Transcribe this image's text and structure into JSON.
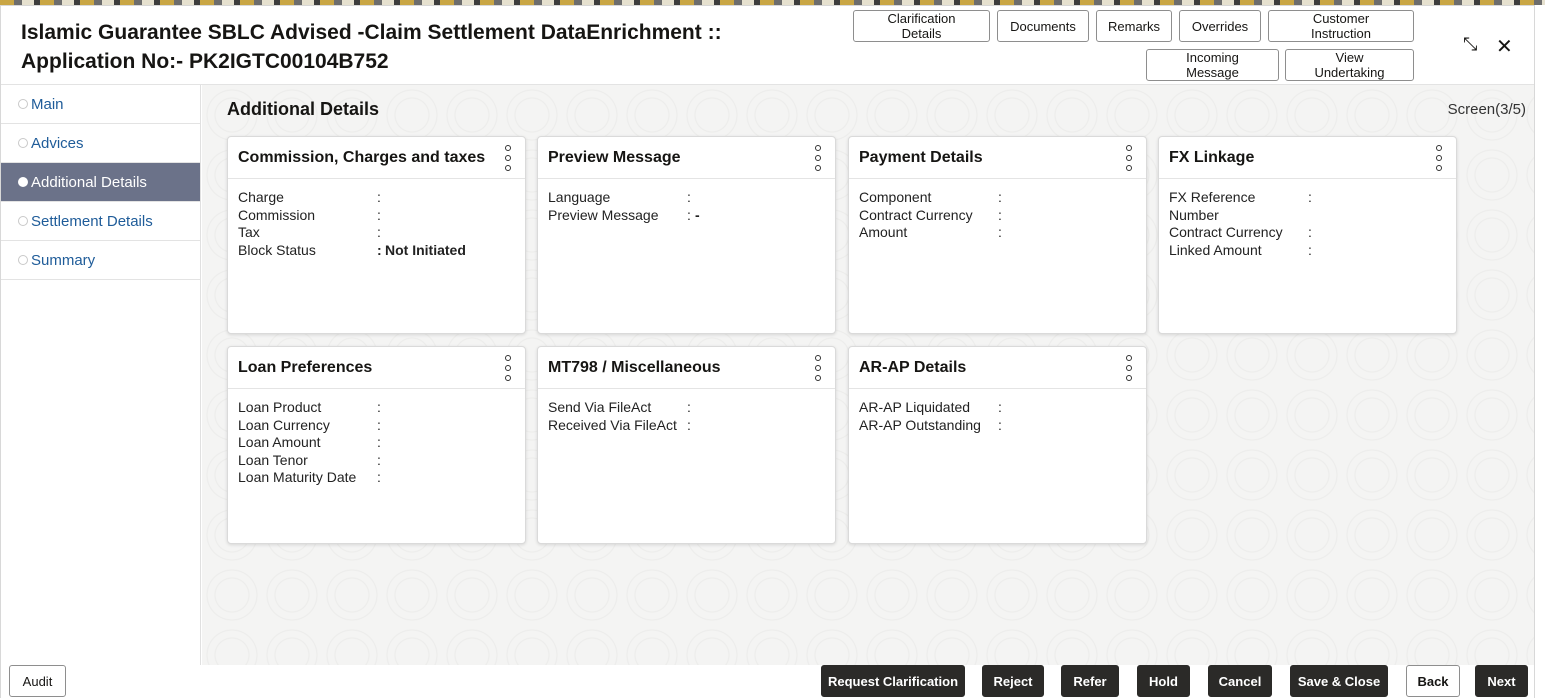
{
  "header": {
    "title_line1": "Islamic Guarantee SBLC Advised -Claim Settlement DataEnrichment ::",
    "title_line2": "Application No:- PK2IGTC00104B752",
    "buttons": {
      "clarification": "Clarification Details",
      "documents": "Documents",
      "remarks": "Remarks",
      "overrides": "Overrides",
      "customer_instruction": "Customer Instruction",
      "incoming_message": "Incoming Message",
      "view_undertaking": "View Undertaking"
    },
    "minimize_glyph": "⤡",
    "close_glyph": "✕"
  },
  "sidebar": {
    "items": [
      {
        "label": "Main"
      },
      {
        "label": "Advices"
      },
      {
        "label": "Additional Details"
      },
      {
        "label": "Settlement Details"
      },
      {
        "label": "Summary"
      }
    ],
    "active_index": 2
  },
  "content": {
    "title": "Additional Details",
    "screen": "Screen(3/5)",
    "cards": {
      "commission": {
        "title": "Commission, Charges and taxes",
        "rows": [
          {
            "label": "Charge",
            "colon": ":",
            "value": ""
          },
          {
            "label": "Commission",
            "colon": ":",
            "value": ""
          },
          {
            "label": "Tax",
            "colon": ":",
            "value": ""
          },
          {
            "label": "Block Status",
            "colon": ":",
            "value": "Not Initiated"
          }
        ]
      },
      "preview": {
        "title": "Preview Message",
        "rows": [
          {
            "label": "Language",
            "colon": ":",
            "value": ""
          },
          {
            "label": "Preview Message",
            "colon": ":",
            "value": "-"
          }
        ]
      },
      "payment": {
        "title": "Payment Details",
        "rows": [
          {
            "label": "Component",
            "colon": ":",
            "value": ""
          },
          {
            "label": "Contract Currency",
            "colon": ":",
            "value": ""
          },
          {
            "label": "Amount",
            "colon": ":",
            "value": ""
          }
        ]
      },
      "fx": {
        "title": "FX Linkage",
        "rows": [
          {
            "label": "FX Reference Number",
            "colon": ":",
            "value": ""
          },
          {
            "label": "Contract Currency",
            "colon": ":",
            "value": ""
          },
          {
            "label": "Linked Amount",
            "colon": ":",
            "value": ""
          }
        ]
      },
      "loan": {
        "title": "Loan Preferences",
        "rows": [
          {
            "label": "Loan Product",
            "colon": ":",
            "value": ""
          },
          {
            "label": "Loan Currency",
            "colon": ":",
            "value": ""
          },
          {
            "label": "Loan Amount",
            "colon": ":",
            "value": ""
          },
          {
            "label": "Loan Tenor",
            "colon": ":",
            "value": ""
          },
          {
            "label": "Loan Maturity Date",
            "colon": ":",
            "value": ""
          }
        ]
      },
      "mt798": {
        "title": "MT798 / Miscellaneous",
        "rows": [
          {
            "label": "Send Via FileAct",
            "colon": ":",
            "value": ""
          },
          {
            "label": "Received Via FileAct",
            "colon": ":",
            "value": ""
          }
        ]
      },
      "arap": {
        "title": "AR-AP Details",
        "rows": [
          {
            "label": "AR-AP Liquidated",
            "colon": ":",
            "value": ""
          },
          {
            "label": "AR-AP Outstanding",
            "colon": ":",
            "value": ""
          }
        ]
      }
    }
  },
  "footer": {
    "audit": "Audit",
    "request_clarification": "Request Clarification",
    "reject": "Reject",
    "refer": "Refer",
    "hold": "Hold",
    "cancel": "Cancel",
    "save_close": "Save & Close",
    "back": "Back",
    "next": "Next"
  },
  "colors": {
    "active_nav": "#6b7289",
    "link": "#1f5c99",
    "dark_button": "#2b2a28"
  }
}
